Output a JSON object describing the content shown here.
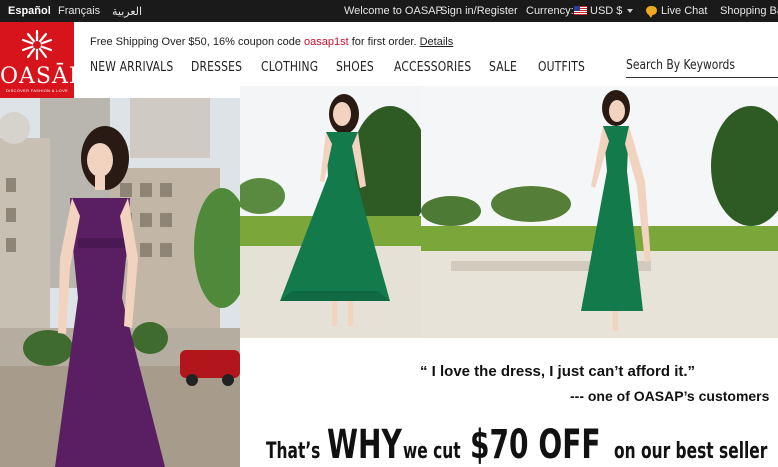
{
  "topbar": {
    "languages": [
      "Español",
      "Français",
      "العربية"
    ],
    "welcome": "Welcome to OASAP.",
    "signin": "Sign in/Register",
    "currency_label": "Currency:",
    "currency_value": "USD $",
    "live_chat": "Live Chat",
    "shopping_bag": "Shopping Bag"
  },
  "logo": {
    "text": "OASĀP",
    "tagline": "DISCOVER FASHION & LOVE"
  },
  "promo": {
    "text_before": "Free Shipping Over $50, 16% coupon code ",
    "code": "oasap1st",
    "text_after": " for first order. ",
    "details": "Details"
  },
  "nav": [
    "NEW ARRIVALS",
    "DRESSES",
    "CLOTHING",
    "SHOES",
    "ACCESSORIES",
    "SALE",
    "OUTFITS"
  ],
  "search": {
    "placeholder": "Search By Keywords"
  },
  "banner": {
    "quote": "“ I love the dress, I just can’t afford it.”",
    "attribution_prefix": "--- one of ",
    "attribution_brand": "OASAP",
    "attribution_suffix": "’s customers",
    "headline": {
      "part1": "That’s",
      "part2": "WHY",
      "part3": "we cut",
      "part4": "$70 OFF",
      "part5": "on our best seller"
    }
  },
  "colors": {
    "brand_red": "#d7141c",
    "topbar_bg": "#1a1a1a",
    "dress_purple": "#5a1f62",
    "dress_green": "#137a4c"
  }
}
